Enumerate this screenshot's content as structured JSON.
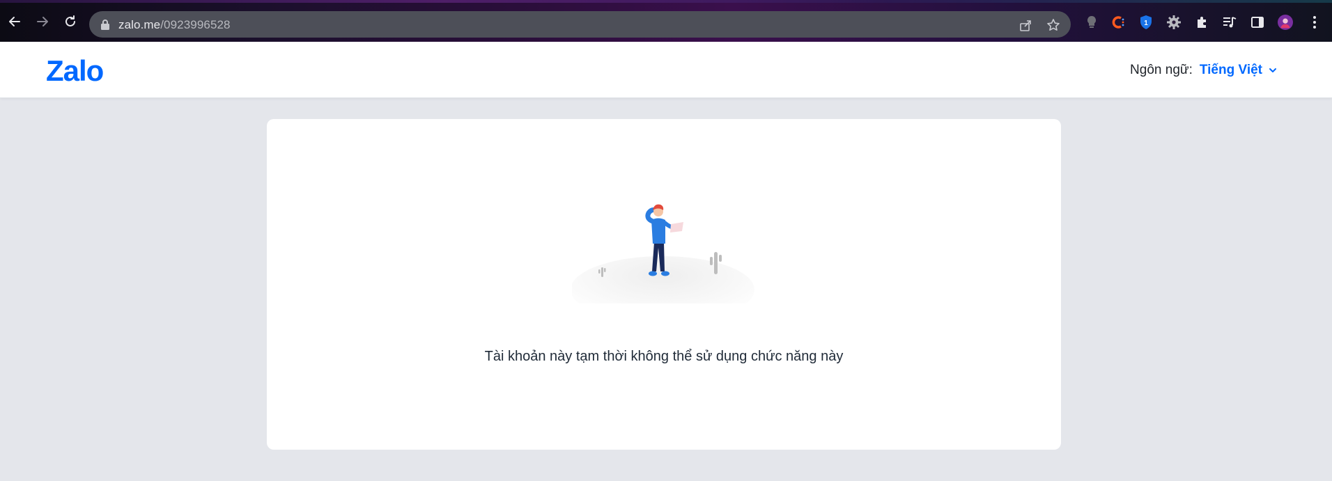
{
  "browser": {
    "url_host": "zalo.me",
    "url_path": "/0923996528",
    "icons": {
      "back": "back-arrow-icon",
      "forward": "forward-arrow-icon",
      "reload": "reload-icon",
      "lock": "lock-icon",
      "share": "share-icon",
      "bookmark": "star-icon",
      "extensions": [
        "bulb-extension-icon",
        "c-extension-icon",
        "password-manager-icon",
        "gear-extension-icon",
        "puzzle-icon",
        "media-queue-icon",
        "sidepanel-icon",
        "profile-avatar-icon",
        "more-menu-icon"
      ]
    },
    "badge_number": "1"
  },
  "header": {
    "logo": "Zalo",
    "language_label": "Ngôn ngữ:",
    "language_value": "Tiếng Việt"
  },
  "card": {
    "message": "Tài khoản này tạm thời không thể sử dụng chức năng này"
  },
  "colors": {
    "brand": "#0068ff",
    "page_bg": "#e4e6eb",
    "card_bg": "#ffffff"
  }
}
